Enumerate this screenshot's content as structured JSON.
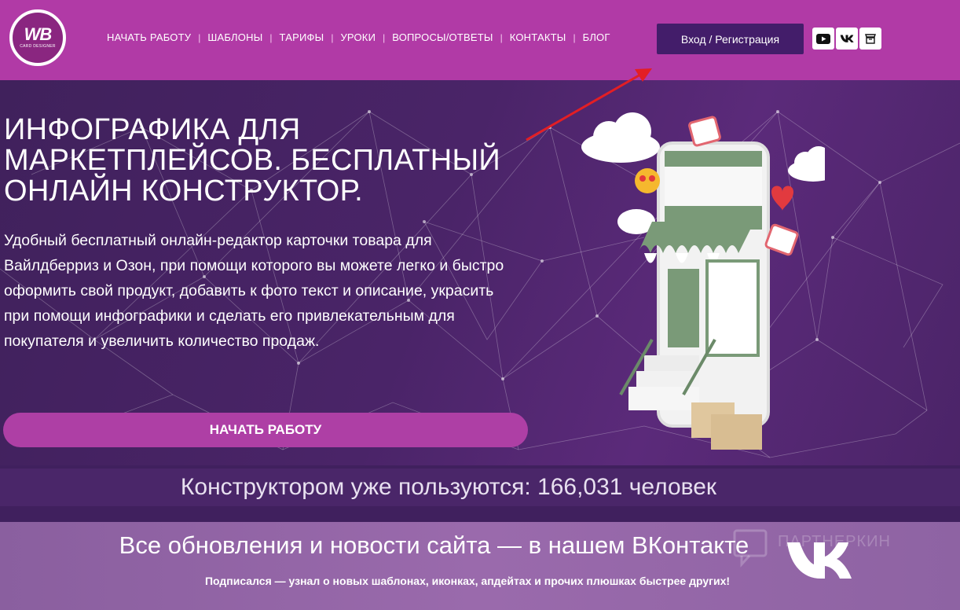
{
  "header": {
    "logo": {
      "main": "WB",
      "sub": "CARD DESIGNER"
    },
    "nav": [
      {
        "label": "НАЧАТЬ РАБОТУ"
      },
      {
        "label": "ШАБЛОНЫ"
      },
      {
        "label": "ТАРИФЫ"
      },
      {
        "label": "УРОКИ"
      },
      {
        "label": "ВОПРОСЫ/ОТВЕТЫ"
      },
      {
        "label": "КОНТАКТЫ"
      },
      {
        "label": "БЛОГ"
      }
    ],
    "separator": "|",
    "login_label": "Вход / Регистрация",
    "social": [
      "youtube-icon",
      "vk-icon",
      "store-icon"
    ]
  },
  "hero": {
    "title": "ИНФОГРАФИКА ДЛЯ МАРКЕТПЛЕЙСОВ. БЕСПЛАТНЫЙ ОНЛАЙН КОНСТРУКТОР.",
    "description": "Удобный бесплатный онлайн-редактор карточки товара для Вайлдберриз и Озон, при помощи которого вы можете легко и быстро оформить свой продукт, добавить к фото текст и описание, украсить при помощи инфографики и  сделать его привлекательным для покупателя и увеличить  количество продаж.",
    "cta_label": "НАЧАТЬ РАБОТУ"
  },
  "counter": {
    "text": "Конструктором уже пользуются: 166,031 человек"
  },
  "vk_section": {
    "title": "Все обновления и новости сайта — в нашем ВКонтакте",
    "subtitle": "Подписался — узнал о новых шаблонах, иконках, апдейтах и прочих плюшках быстрее других!",
    "watermark": "ПАРТНЕРКИН"
  },
  "colors": {
    "header_bg": "#b13aa6",
    "login_bg": "#431d6a",
    "hero_bg": "#4a2468",
    "cta_bg": "#ae3fa5",
    "arrow": "#e31e24"
  }
}
